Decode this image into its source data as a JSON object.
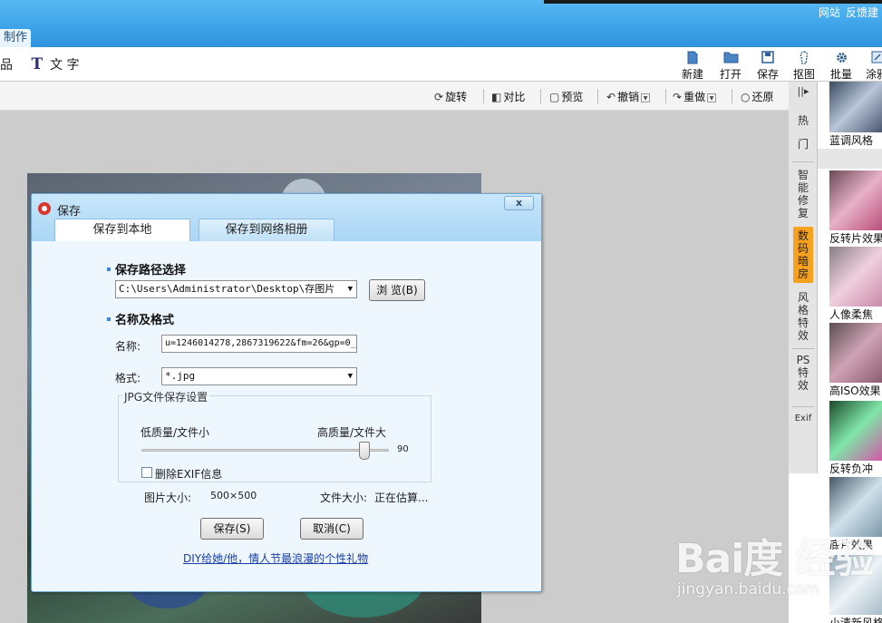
{
  "header": {
    "links": [
      "网站",
      "反馈建"
    ],
    "active_tab": "制作"
  },
  "toolbar": {
    "left_partial": "品",
    "text_tool_icon": "T",
    "text_tool_label": "文 字",
    "buttons": [
      {
        "icon": "new-file-icon",
        "label": "新建"
      },
      {
        "icon": "open-folder-icon",
        "label": "打开"
      },
      {
        "icon": "save-disk-icon",
        "label": "保存"
      },
      {
        "icon": "cutout-icon",
        "label": "抠图"
      },
      {
        "icon": "batch-gear-icon",
        "label": "批量"
      },
      {
        "icon": "paint-icon",
        "label": "涂鸦"
      }
    ]
  },
  "editbar": {
    "rotate": "旋转",
    "compare": "对比",
    "preview": "预览",
    "undo": "撤销",
    "redo": "重做",
    "restore": "还原"
  },
  "side_tabs": {
    "hot": "热门",
    "smart": "智能修复",
    "darkroom": "数码暗房",
    "style": "风格特效",
    "ps": "PS特效",
    "exif": "Exif"
  },
  "thumbnails": [
    "蓝调风格",
    "反转片效果",
    "人像柔焦",
    "高ISO效果",
    "反转负冲",
    "底片效果",
    "小清新风格"
  ],
  "watermark": {
    "line1": "Bai度 经验",
    "line2": "jingyan.baidu.com"
  },
  "dialog": {
    "title": "保存",
    "close": "x",
    "tabs": [
      "保存到本地",
      "保存到网络相册"
    ],
    "section_path": "保存路径选择",
    "path_value": "C:\\Users\\Administrator\\Desktop\\存图片",
    "browse": "浏 览(B)",
    "section_name": "名称及格式",
    "name_label": "名称:",
    "name_value": "u=1246014278,2867319622&fm=26&gp=0_",
    "format_label": "格式:",
    "format_value": "*.jpg",
    "jpg_group": "JPG文件保存设置",
    "low_quality": "低质量/文件小",
    "high_quality": "高质量/文件大",
    "quality_value": "90",
    "quality_fraction": 0.9,
    "remove_exif": "删除EXIF信息",
    "image_size_label": "图片大小:",
    "image_size_value": "500×500",
    "file_size_label": "文件大小:",
    "file_size_value": "正在估算...",
    "save_button": "保存(S)",
    "cancel_button": "取消(C)",
    "ad_link": "DIY给她/他，情人节最浪漫的个性礼物"
  }
}
